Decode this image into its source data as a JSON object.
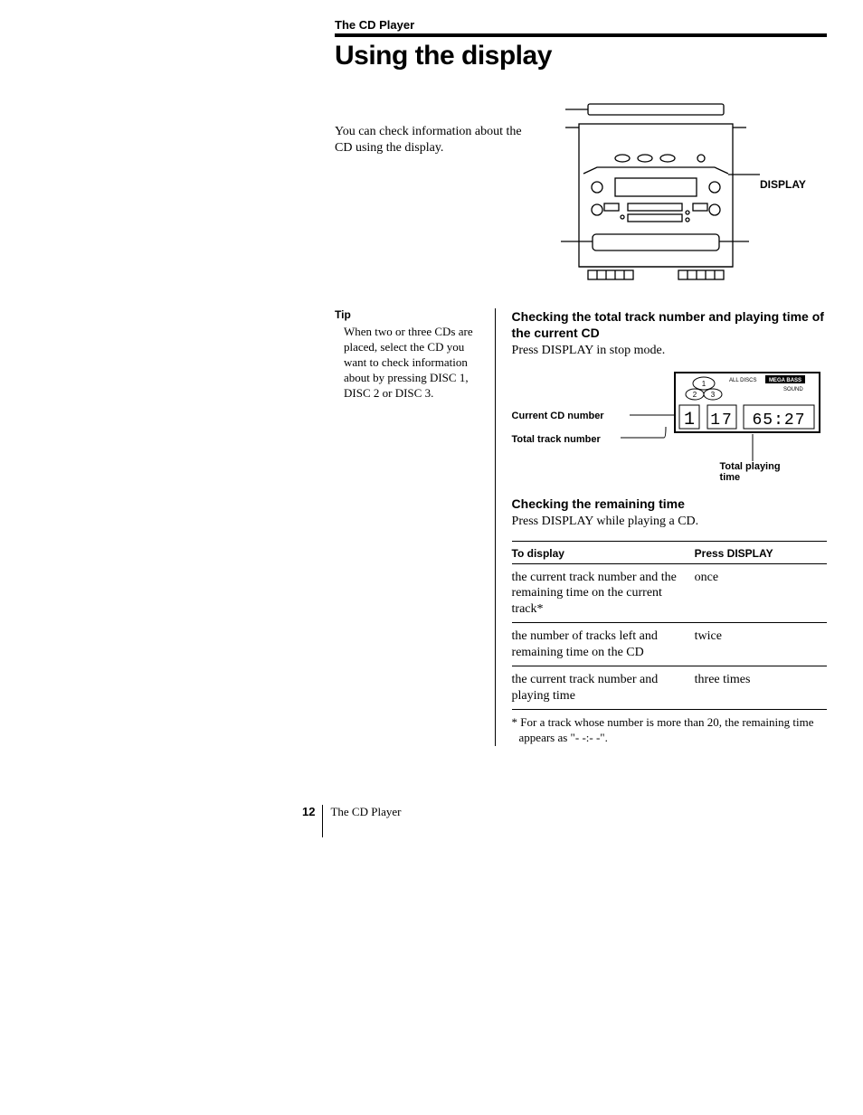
{
  "header": {
    "section": "The CD Player",
    "title": "Using the display"
  },
  "intro": "You can check information about the CD using the display.",
  "device_callout": "DISPLAY",
  "tip": {
    "heading": "Tip",
    "body": "When two or three CDs are placed, select the CD you want to check information about by pressing DISC 1, DISC 2 or DISC 3."
  },
  "section1": {
    "heading": "Checking the total track number and playing time of the current CD",
    "body": "Press DISPLAY in stop mode.",
    "callouts": {
      "current_cd": "Current CD number",
      "total_track": "Total track number",
      "total_time": "Total playing time"
    },
    "lcd": {
      "indicator_left": "ALL DISCS",
      "indicator_right": "MEGA BASS",
      "indicator_sub": "SOUND",
      "disc_current": "1",
      "disc_b": "2",
      "disc_c": "3",
      "track_big": "1",
      "tracks": "17",
      "time": "65:27"
    }
  },
  "section2": {
    "heading": "Checking the remaining time",
    "body": "Press DISPLAY while playing a CD.",
    "table": {
      "headers": [
        "To display",
        "Press DISPLAY"
      ],
      "rows": [
        [
          "the current track number and the remaining time on the current track*",
          "once"
        ],
        [
          "the number of tracks left and remaining time on the CD",
          "twice"
        ],
        [
          "the current track number and playing time",
          "three times"
        ]
      ]
    },
    "footnote": "* For a track whose number is more than 20, the remaining time appears as \"- -:- -\"."
  },
  "footer": {
    "page_number": "12",
    "section": "The CD Player"
  }
}
